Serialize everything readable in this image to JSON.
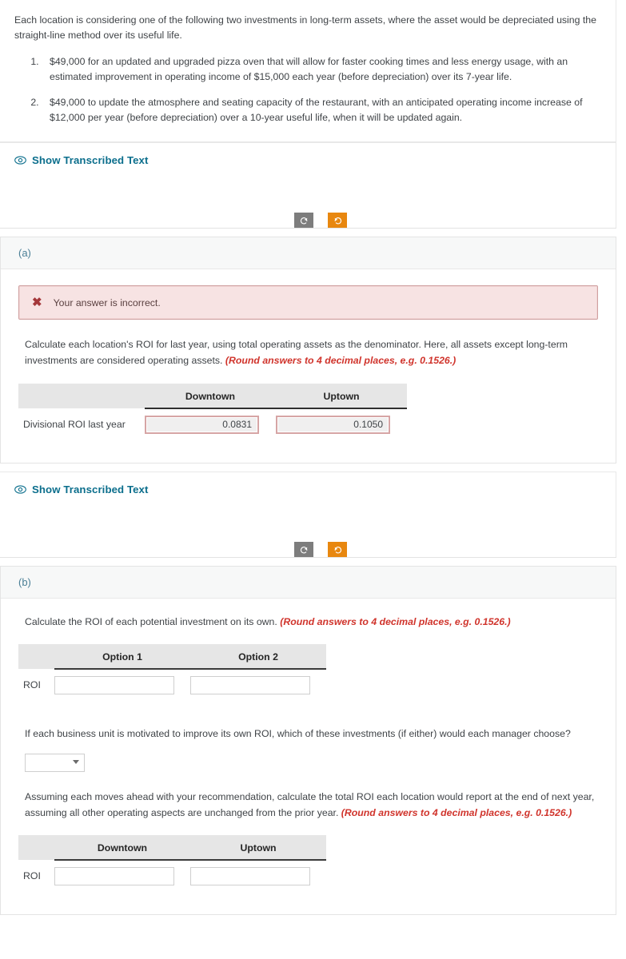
{
  "intro": {
    "paragraph": "Each location is considering one of the following two investments in long-term assets, where the asset would be depreciated using the straight-line method over its useful life.",
    "items": [
      "$49,000 for an updated and upgraded pizza oven that will allow for faster cooking times and less energy usage, with an estimated improvement in operating income of $15,000 each year (before depreciation) over its 7-year life.",
      "$49,000 to update the atmosphere and seating capacity of the restaurant, with an anticipated operating income increase of $12,000 per year (before depreciation) over a 10-year useful life, when it will be updated again."
    ]
  },
  "transcribe": {
    "label": "Show Transcribed Text",
    "icon": "eye-icon"
  },
  "tools": {
    "undo_icon": "undo-arrow-icon",
    "redo_icon": "redo-arrow-icon",
    "undo_label": "",
    "redo_label": ""
  },
  "colors": {
    "link": "#0b6e8c",
    "section_label": "#4a7f96",
    "alert_bg": "#f7e3e3",
    "alert_border": "#cfa0a0",
    "alert_x": "#a4373a",
    "round_note": "#d0342c",
    "tool_grey": "#7d7d7d",
    "tool_orange": "#e8870f",
    "table_header_bg": "#e6e6e6",
    "wrong_input_border": "#d6a5a5"
  },
  "section_a": {
    "label": "(a)",
    "alert": {
      "icon": "x-mark-icon",
      "text": "Your answer is incorrect."
    },
    "prompt_main": "Calculate each location's ROI for last year, using total operating assets as the denominator. Here, all assets except long-term investments are considered operating assets.",
    "prompt_note": "(Round answers to 4 decimal places, e.g. 0.1526.)",
    "table": {
      "columns": [
        "Downtown",
        "Uptown"
      ],
      "rows": [
        {
          "label": "Divisional ROI last year",
          "values": [
            "0.0831",
            "0.1050"
          ],
          "state": "incorrect"
        }
      ]
    }
  },
  "section_b": {
    "label": "(b)",
    "prompt_1_main": "Calculate the ROI of each potential investment on its own.",
    "prompt_1_note": "(Round answers to 4 decimal places, e.g. 0.1526.)",
    "table_1": {
      "columns": [
        "Option 1",
        "Option 2"
      ],
      "rows": [
        {
          "label": "ROI",
          "values": [
            "",
            ""
          ],
          "state": "empty"
        }
      ]
    },
    "prompt_2": "If each business unit is motivated to improve its own ROI, which of these investments (if either) would each manager choose?",
    "dropdown": {
      "value": "",
      "placeholder": "",
      "icon": "chevron-down-icon"
    },
    "prompt_3_main": "Assuming each moves ahead with your recommendation, calculate the total ROI each location would report at the end of next year, assuming all other operating aspects are unchanged from the prior year.",
    "prompt_3_note": "(Round answers to 4 decimal places, e.g. 0.1526.)",
    "table_2": {
      "columns": [
        "Downtown",
        "Uptown"
      ],
      "rows": [
        {
          "label": "ROI",
          "values": [
            "",
            ""
          ],
          "state": "empty"
        }
      ]
    }
  }
}
